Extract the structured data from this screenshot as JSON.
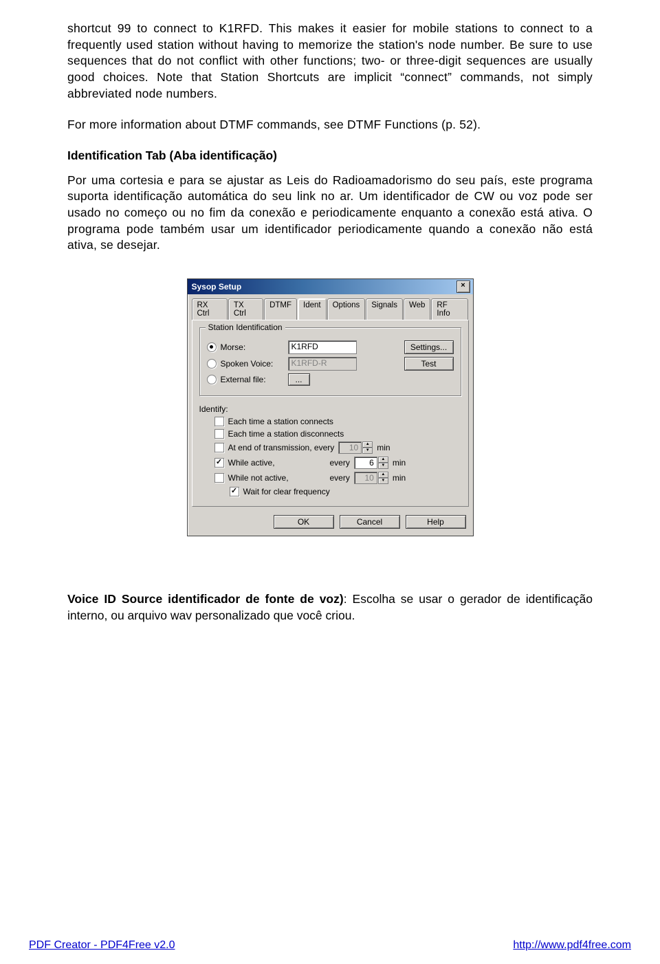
{
  "paragraphs": {
    "p1": "shortcut 99 to connect to K1RFD. This makes it easier for mobile stations to connect to a frequently used station without having to memorize the station's node number. Be sure to use sequences that do not conflict with other functions; two- or three-digit sequences are usually good choices. Note that Station Shortcuts are implicit “connect” commands, not simply abbreviated node numbers.",
    "p2": "For more information about DTMF commands, see DTMF Functions (p. 52).",
    "h1": "Identification Tab (Aba identificação)",
    "p3": "Por uma cortesia e para se ajustar as Leis do Radioamadorismo do seu país, este programa suporta identificação automática do seu link no ar. Um identificador de CW ou voz pode ser usado no começo ou no fim da conexão e periodicamente enquanto a conexão está ativa. O programa pode também usar um identificador periodicamente quando a conexão não está ativa, se desejar.",
    "voice_lead": "Voice ID Source identificador de fonte de voz)",
    "voice_tail": ": Escolha se usar o gerador de identificação interno, ou arquivo wav personalizado que você criou."
  },
  "dialog": {
    "title": "Sysop Setup",
    "tabs": [
      "RX Ctrl",
      "TX Ctrl",
      "DTMF",
      "Ident",
      "Options",
      "Signals",
      "Web",
      "RF Info"
    ],
    "active_tab": "Ident",
    "group": "Station Identification",
    "morse_label": "Morse:",
    "morse_value": "K1RFD",
    "settings_btn": "Settings...",
    "voice_label": "Spoken Voice:",
    "voice_value": "K1RFD-R",
    "test_btn": "Test",
    "extfile_label": "External file:",
    "extfile_btn": "...",
    "identify_label": "Identify:",
    "chk_connect": "Each time a station connects",
    "chk_disconnect": "Each time a station disconnects",
    "chk_end_tx": "At end of transmission, every",
    "chk_active": "While active,",
    "chk_notactive": "While not active,",
    "chk_clear": "Wait for clear frequency",
    "every": "every",
    "min": "min",
    "val_endtx": "10",
    "val_active": "6",
    "val_notactive": "10",
    "ok": "OK",
    "cancel": "Cancel",
    "help": "Help"
  },
  "footer": {
    "left_link": "PDF Creator - PDF4Free v2.0",
    "right_link": "http://www.pdf4free.com"
  }
}
